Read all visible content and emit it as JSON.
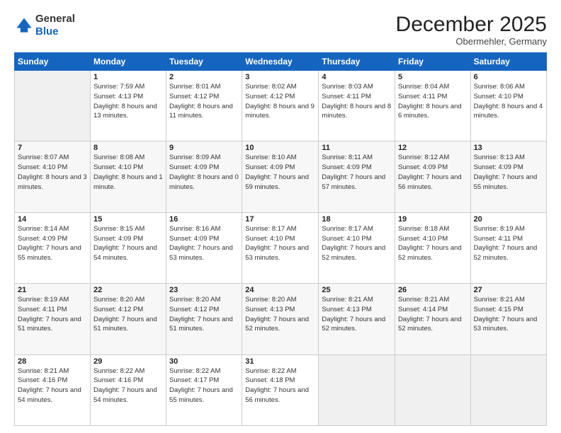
{
  "logo": {
    "general": "General",
    "blue": "Blue"
  },
  "header": {
    "month": "December 2025",
    "location": "Obermehler, Germany"
  },
  "days_of_week": [
    "Sunday",
    "Monday",
    "Tuesday",
    "Wednesday",
    "Thursday",
    "Friday",
    "Saturday"
  ],
  "weeks": [
    [
      {
        "day": "",
        "sunrise": "",
        "sunset": "",
        "daylight": ""
      },
      {
        "day": "1",
        "sunrise": "Sunrise: 7:59 AM",
        "sunset": "Sunset: 4:13 PM",
        "daylight": "Daylight: 8 hours and 13 minutes."
      },
      {
        "day": "2",
        "sunrise": "Sunrise: 8:01 AM",
        "sunset": "Sunset: 4:12 PM",
        "daylight": "Daylight: 8 hours and 11 minutes."
      },
      {
        "day": "3",
        "sunrise": "Sunrise: 8:02 AM",
        "sunset": "Sunset: 4:12 PM",
        "daylight": "Daylight: 8 hours and 9 minutes."
      },
      {
        "day": "4",
        "sunrise": "Sunrise: 8:03 AM",
        "sunset": "Sunset: 4:11 PM",
        "daylight": "Daylight: 8 hours and 8 minutes."
      },
      {
        "day": "5",
        "sunrise": "Sunrise: 8:04 AM",
        "sunset": "Sunset: 4:11 PM",
        "daylight": "Daylight: 8 hours and 6 minutes."
      },
      {
        "day": "6",
        "sunrise": "Sunrise: 8:06 AM",
        "sunset": "Sunset: 4:10 PM",
        "daylight": "Daylight: 8 hours and 4 minutes."
      }
    ],
    [
      {
        "day": "7",
        "sunrise": "Sunrise: 8:07 AM",
        "sunset": "Sunset: 4:10 PM",
        "daylight": "Daylight: 8 hours and 3 minutes."
      },
      {
        "day": "8",
        "sunrise": "Sunrise: 8:08 AM",
        "sunset": "Sunset: 4:10 PM",
        "daylight": "Daylight: 8 hours and 1 minute."
      },
      {
        "day": "9",
        "sunrise": "Sunrise: 8:09 AM",
        "sunset": "Sunset: 4:09 PM",
        "daylight": "Daylight: 8 hours and 0 minutes."
      },
      {
        "day": "10",
        "sunrise": "Sunrise: 8:10 AM",
        "sunset": "Sunset: 4:09 PM",
        "daylight": "Daylight: 7 hours and 59 minutes."
      },
      {
        "day": "11",
        "sunrise": "Sunrise: 8:11 AM",
        "sunset": "Sunset: 4:09 PM",
        "daylight": "Daylight: 7 hours and 57 minutes."
      },
      {
        "day": "12",
        "sunrise": "Sunrise: 8:12 AM",
        "sunset": "Sunset: 4:09 PM",
        "daylight": "Daylight: 7 hours and 56 minutes."
      },
      {
        "day": "13",
        "sunrise": "Sunrise: 8:13 AM",
        "sunset": "Sunset: 4:09 PM",
        "daylight": "Daylight: 7 hours and 55 minutes."
      }
    ],
    [
      {
        "day": "14",
        "sunrise": "Sunrise: 8:14 AM",
        "sunset": "Sunset: 4:09 PM",
        "daylight": "Daylight: 7 hours and 55 minutes."
      },
      {
        "day": "15",
        "sunrise": "Sunrise: 8:15 AM",
        "sunset": "Sunset: 4:09 PM",
        "daylight": "Daylight: 7 hours and 54 minutes."
      },
      {
        "day": "16",
        "sunrise": "Sunrise: 8:16 AM",
        "sunset": "Sunset: 4:09 PM",
        "daylight": "Daylight: 7 hours and 53 minutes."
      },
      {
        "day": "17",
        "sunrise": "Sunrise: 8:17 AM",
        "sunset": "Sunset: 4:10 PM",
        "daylight": "Daylight: 7 hours and 53 minutes."
      },
      {
        "day": "18",
        "sunrise": "Sunrise: 8:17 AM",
        "sunset": "Sunset: 4:10 PM",
        "daylight": "Daylight: 7 hours and 52 minutes."
      },
      {
        "day": "19",
        "sunrise": "Sunrise: 8:18 AM",
        "sunset": "Sunset: 4:10 PM",
        "daylight": "Daylight: 7 hours and 52 minutes."
      },
      {
        "day": "20",
        "sunrise": "Sunrise: 8:19 AM",
        "sunset": "Sunset: 4:11 PM",
        "daylight": "Daylight: 7 hours and 52 minutes."
      }
    ],
    [
      {
        "day": "21",
        "sunrise": "Sunrise: 8:19 AM",
        "sunset": "Sunset: 4:11 PM",
        "daylight": "Daylight: 7 hours and 51 minutes."
      },
      {
        "day": "22",
        "sunrise": "Sunrise: 8:20 AM",
        "sunset": "Sunset: 4:12 PM",
        "daylight": "Daylight: 7 hours and 51 minutes."
      },
      {
        "day": "23",
        "sunrise": "Sunrise: 8:20 AM",
        "sunset": "Sunset: 4:12 PM",
        "daylight": "Daylight: 7 hours and 51 minutes."
      },
      {
        "day": "24",
        "sunrise": "Sunrise: 8:20 AM",
        "sunset": "Sunset: 4:13 PM",
        "daylight": "Daylight: 7 hours and 52 minutes."
      },
      {
        "day": "25",
        "sunrise": "Sunrise: 8:21 AM",
        "sunset": "Sunset: 4:13 PM",
        "daylight": "Daylight: 7 hours and 52 minutes."
      },
      {
        "day": "26",
        "sunrise": "Sunrise: 8:21 AM",
        "sunset": "Sunset: 4:14 PM",
        "daylight": "Daylight: 7 hours and 52 minutes."
      },
      {
        "day": "27",
        "sunrise": "Sunrise: 8:21 AM",
        "sunset": "Sunset: 4:15 PM",
        "daylight": "Daylight: 7 hours and 53 minutes."
      }
    ],
    [
      {
        "day": "28",
        "sunrise": "Sunrise: 8:21 AM",
        "sunset": "Sunset: 4:16 PM",
        "daylight": "Daylight: 7 hours and 54 minutes."
      },
      {
        "day": "29",
        "sunrise": "Sunrise: 8:22 AM",
        "sunset": "Sunset: 4:16 PM",
        "daylight": "Daylight: 7 hours and 54 minutes."
      },
      {
        "day": "30",
        "sunrise": "Sunrise: 8:22 AM",
        "sunset": "Sunset: 4:17 PM",
        "daylight": "Daylight: 7 hours and 55 minutes."
      },
      {
        "day": "31",
        "sunrise": "Sunrise: 8:22 AM",
        "sunset": "Sunset: 4:18 PM",
        "daylight": "Daylight: 7 hours and 56 minutes."
      },
      {
        "day": "",
        "sunrise": "",
        "sunset": "",
        "daylight": ""
      },
      {
        "day": "",
        "sunrise": "",
        "sunset": "",
        "daylight": ""
      },
      {
        "day": "",
        "sunrise": "",
        "sunset": "",
        "daylight": ""
      }
    ]
  ]
}
